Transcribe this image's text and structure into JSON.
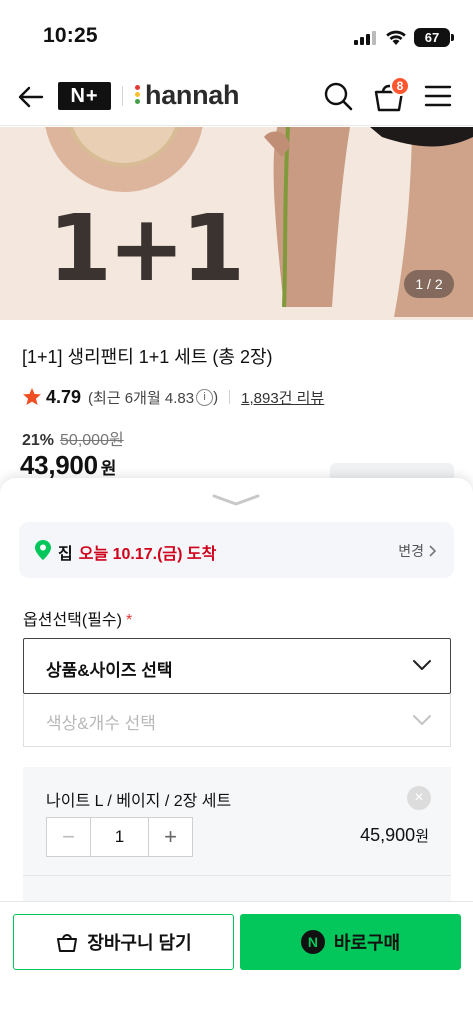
{
  "status": {
    "time": "10:25",
    "battery": "67"
  },
  "header": {
    "nplus_logo": "N+",
    "brand_name": "hannah",
    "cart_count": "8"
  },
  "hero": {
    "promo_text": "1+1",
    "counter": "1 / 2"
  },
  "product": {
    "title": "[1+1] 생리팬티 1+1 세트 (총 2장)",
    "rating": "4.79",
    "rating_recent": "(최근 6개월 4.83",
    "rating_info_icon": "i",
    "rating_recent_close": ")",
    "reviews": "1,893건 리뷰",
    "discount": "21%",
    "original_price": "50,000원",
    "sale_price": "43,900",
    "price_unit": "원"
  },
  "delivery": {
    "place": "집",
    "date": "오늘 10.17.(금) 도착",
    "change_label": "변경"
  },
  "options": {
    "label": "옵션선택(필수)",
    "required_mark": "*",
    "select1": "상품&사이즈 선택",
    "select2": "색상&개수 선택"
  },
  "selected_item": {
    "name": "나이트 L / 베이지 / 2장 세트",
    "quantity": "1",
    "price": "45,900",
    "price_unit": "원",
    "minus": "−",
    "plus": "+",
    "remove": "×"
  },
  "actions": {
    "cart_label": "장바구니 담기",
    "buy_label": "바로구매",
    "npay_icon": "N"
  },
  "colors": {
    "accent_green": "#03c75a",
    "delivery_red": "#d0021b",
    "badge_red": "#ff5630",
    "star": "#f04e23"
  }
}
